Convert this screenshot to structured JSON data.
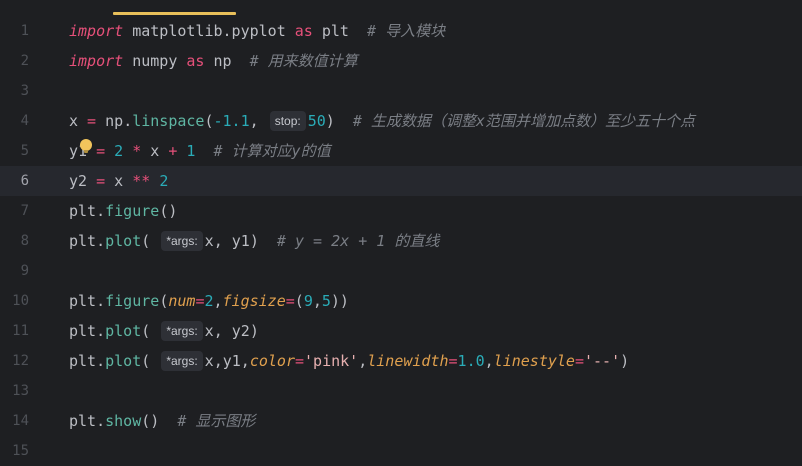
{
  "lines": [
    {
      "n": "1",
      "tokens": [
        "import",
        " matplotlib.pyplot ",
        "as",
        " plt  ",
        "# 导入模块"
      ]
    },
    {
      "n": "2",
      "tokens": [
        "import",
        " numpy ",
        "as",
        " np  ",
        "# 用来数值计算"
      ]
    },
    {
      "n": "3"
    },
    {
      "n": "4",
      "tokens": [
        "x",
        " = ",
        "np",
        ".",
        "linspace",
        "(",
        "-1.1",
        ",",
        "stop:",
        "50",
        ")",
        "  # 生成数据（调整x范围并增加点数）至少五十个点"
      ]
    },
    {
      "n": "5",
      "tokens": [
        "y1",
        " = ",
        "2",
        " * ",
        "x",
        " + ",
        "1",
        "  # 计算对应y的值"
      ]
    },
    {
      "n": "6",
      "tokens": [
        "y2",
        " = ",
        "x",
        " ** ",
        "2"
      ]
    },
    {
      "n": "7",
      "tokens": [
        "plt",
        ".",
        "figure",
        "()"
      ]
    },
    {
      "n": "8",
      "tokens": [
        "plt",
        ".",
        "plot",
        "(",
        "*args:",
        "x, y1",
        ")",
        "  # y = 2x + 1 的直线"
      ]
    },
    {
      "n": "9"
    },
    {
      "n": "10",
      "tokens": [
        "plt",
        ".",
        "figure",
        "(",
        "num",
        "=",
        "2",
        ",",
        "figsize",
        "=",
        "(",
        "9",
        ",",
        "5",
        "))"
      ]
    },
    {
      "n": "11",
      "tokens": [
        "plt",
        ".",
        "plot",
        "(",
        "*args:",
        "x, y2",
        ")"
      ]
    },
    {
      "n": "12",
      "tokens": [
        "plt",
        ".",
        "plot",
        "(",
        "*args:",
        "x,y1,",
        "color",
        "=",
        "'pink'",
        ",",
        "linewidth",
        "=",
        "1.0",
        ",",
        "linestyle",
        "=",
        "'--'",
        ")"
      ]
    },
    {
      "n": "13"
    },
    {
      "n": "14",
      "tokens": [
        "plt",
        ".",
        "show",
        "()",
        "  # 显示图形"
      ]
    },
    {
      "n": "15"
    }
  ],
  "current_line": "6",
  "colors": {
    "background": "#1e1f22",
    "current_line": "#26282e",
    "keyword": "#e6507a",
    "function": "#56a8f5",
    "number": "#2aacb8",
    "comment": "#7a7e85",
    "kwarg": "#e0a04e",
    "string": "#e7b0b0",
    "accent": "#e8bf5a"
  },
  "icons": {
    "intention": "lightbulb-icon"
  }
}
